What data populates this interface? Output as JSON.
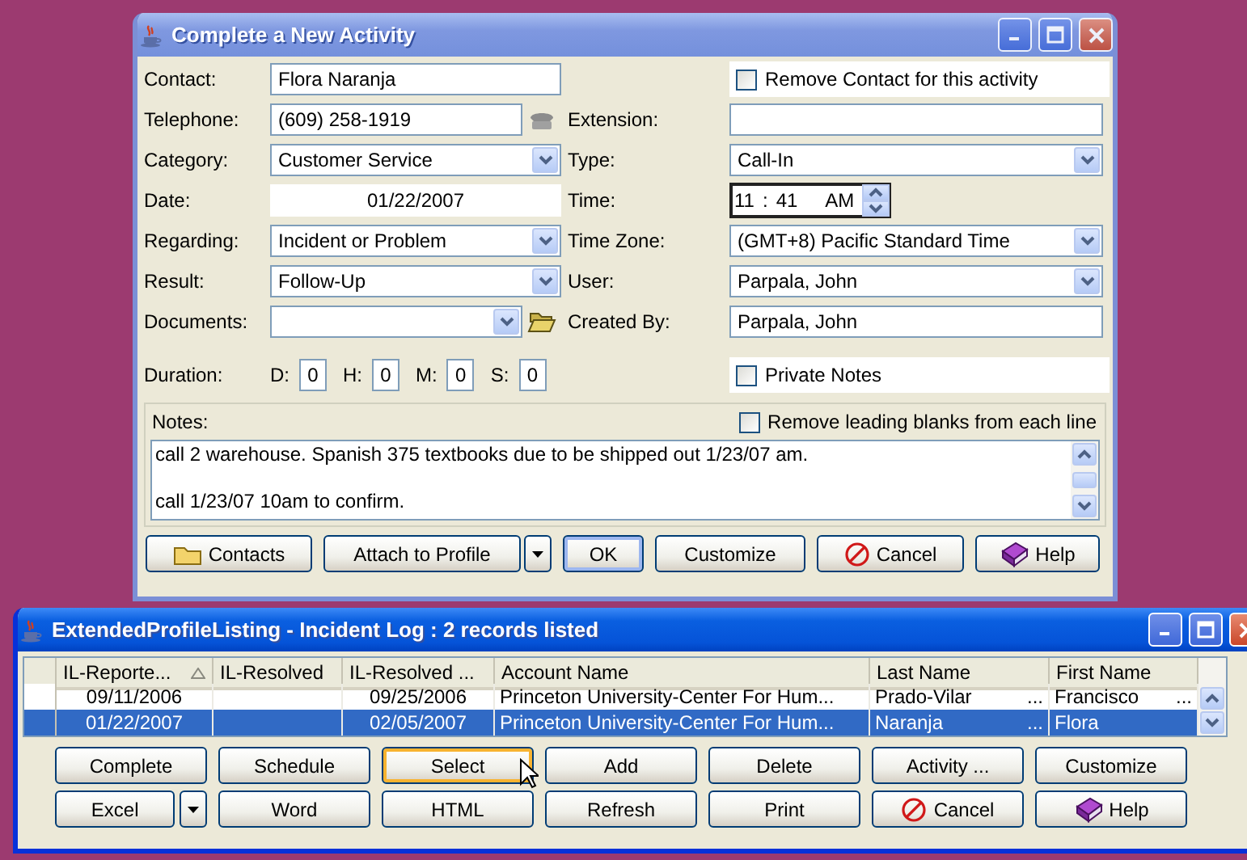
{
  "activity_window": {
    "title": "Complete a New Activity",
    "active": false,
    "rows": [
      {
        "left": {
          "label": "Contact:",
          "kind": "text",
          "value": "Flora Naranja"
        },
        "right": {
          "kind": "checkbox",
          "label": "Remove Contact for this activity",
          "checked": false
        }
      },
      {
        "left": {
          "label": "Telephone:",
          "kind": "phone",
          "value": "(609) 258-1919"
        },
        "right": {
          "label": "Extension:",
          "kind": "text"
        }
      },
      {
        "left": {
          "label": "Category:",
          "kind": "combo",
          "value": "Customer Service"
        },
        "right": {
          "label": "Type:",
          "kind": "combo",
          "value": "Call-In"
        }
      },
      {
        "left": {
          "label": "Date:",
          "kind": "date",
          "value": "01/22/2007"
        },
        "right": {
          "label": "Time:",
          "kind": "time",
          "hour": "11",
          "separator": ":",
          "minute": "41",
          "ampm": "AM"
        }
      },
      {
        "left": {
          "label": "Regarding:",
          "kind": "combo",
          "value": "Incident or Problem"
        },
        "right": {
          "label": "Time Zone:",
          "kind": "combo",
          "value": "(GMT+8) Pacific Standard Time"
        }
      },
      {
        "left": {
          "label": "Result:",
          "kind": "combo",
          "value": "Follow-Up"
        },
        "right": {
          "label": "User:",
          "kind": "combo",
          "value": "Parpala, John"
        }
      },
      {
        "left": {
          "label": "Documents:",
          "kind": "documents"
        },
        "right": {
          "label": "Created By:",
          "kind": "text",
          "value": "Parpala, John"
        }
      }
    ],
    "duration": {
      "label": "Duration:",
      "parts": [
        {
          "label": "D:",
          "value": "0"
        },
        {
          "label": "H:",
          "value": "0"
        },
        {
          "label": "M:",
          "value": "0"
        },
        {
          "label": "S:",
          "value": "0"
        }
      ]
    },
    "private_notes": {
      "label": "Private Notes",
      "checked": false
    },
    "notes": {
      "label": "Notes:",
      "remove_blanks": {
        "label": "Remove leading blanks from each line",
        "checked": false
      },
      "paragraphs": [
        "call 2 warehouse. Spanish 375 textbooks due to be shipped out 1/23/07 am.",
        "call 1/23/07 10am to confirm."
      ]
    },
    "buttons": [
      {
        "label": "Contacts",
        "kind": "folder"
      },
      {
        "label": "Attach to Profile",
        "kind": "split"
      },
      {
        "label": "OK",
        "kind": "default"
      },
      {
        "label": "Customize",
        "kind": "plain"
      },
      {
        "label": "Cancel",
        "kind": "stop"
      },
      {
        "label": "Help",
        "kind": "book"
      }
    ]
  },
  "listing_window": {
    "title": "ExtendedProfileListing - Incident Log : 2 records listed",
    "active": true,
    "table": {
      "columns": [
        {
          "label": "IL-Reporte...",
          "kind": "date",
          "sorted": true
        },
        {
          "label": "IL-Resolved",
          "kind": "date",
          "sorted": false
        },
        {
          "label": "IL-Resolved ...",
          "kind": "date",
          "sorted": false
        },
        {
          "label": "Account Name",
          "kind": "text",
          "sorted": false
        },
        {
          "label": "Last Name",
          "kind": "text",
          "sorted": false
        },
        {
          "label": "First Name",
          "kind": "text",
          "sorted": false
        }
      ],
      "rows": [
        {
          "selected": false,
          "cells": [
            {
              "text": "09/11/2006"
            },
            {},
            {
              "text": "09/25/2006"
            },
            {
              "text": "Princeton University-Center For Hum..."
            },
            {
              "text": "Prado-Vilar",
              "more": "..."
            },
            {
              "text": "Francisco",
              "more": "..."
            }
          ]
        },
        {
          "selected": true,
          "cells": [
            {
              "text": "01/22/2007"
            },
            {},
            {
              "text": "02/05/2007"
            },
            {
              "text": "Princeton University-Center For Hum..."
            },
            {
              "text": "Naranja",
              "more": "..."
            },
            {
              "text": "Flora"
            }
          ]
        }
      ]
    },
    "buttons": [
      {
        "label": "Complete",
        "kind": "plain",
        "hovered": false
      },
      {
        "label": "Schedule",
        "kind": "plain",
        "hovered": false
      },
      {
        "label": "Select",
        "kind": "plain",
        "hovered": true
      },
      {
        "label": "Add",
        "kind": "plain",
        "hovered": false
      },
      {
        "label": "Delete",
        "kind": "plain",
        "hovered": false
      },
      {
        "label": "Activity ...",
        "kind": "plain",
        "hovered": false
      },
      {
        "label": "Customize",
        "kind": "plain",
        "hovered": false
      },
      {
        "label": "Excel",
        "kind": "split",
        "hovered": false
      },
      {
        "label": "Word",
        "kind": "plain",
        "hovered": false
      },
      {
        "label": "HTML",
        "kind": "plain",
        "hovered": false
      },
      {
        "label": "Refresh",
        "kind": "plain",
        "hovered": false
      },
      {
        "label": "Print",
        "kind": "plain",
        "hovered": false
      },
      {
        "label": "Cancel",
        "kind": "stop",
        "hovered": false
      },
      {
        "label": "Help",
        "kind": "book",
        "hovered": false
      }
    ]
  }
}
